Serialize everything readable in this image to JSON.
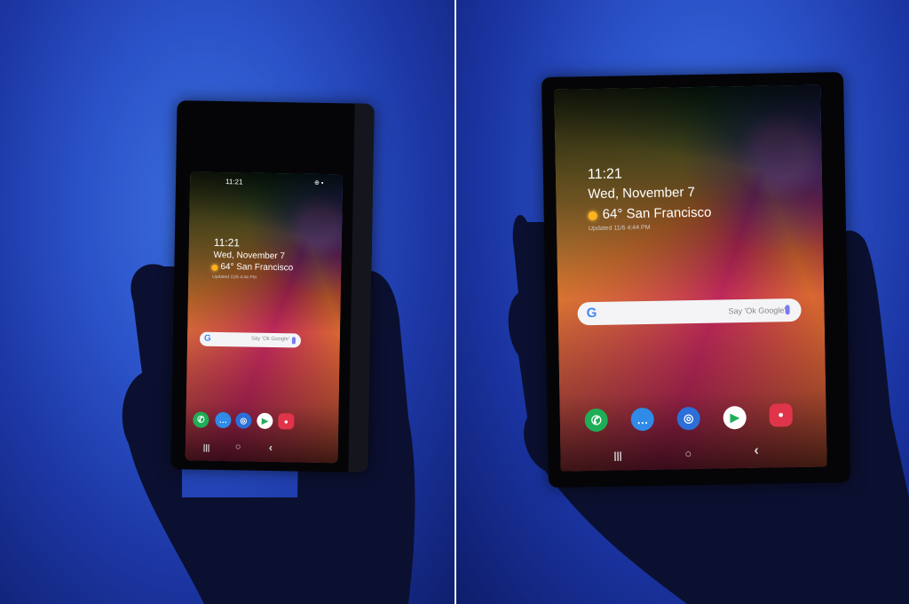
{
  "scene": {
    "description_free": true
  },
  "folded_phone": {
    "status_time": "11:21",
    "status_icons": "⊕ ▪",
    "clock": "11:21",
    "date": "Wed, November 7",
    "weather": "64° San Francisco",
    "updated": "Updated 11/6 4:44 PM",
    "search_placeholder": "Say 'Ok Google'",
    "google_logo": "G",
    "apps": [
      "phone-icon",
      "messages-icon",
      "internet-icon",
      "play-store-icon",
      "camera-icon"
    ],
    "nav": {
      "recent": "|||",
      "home": "○",
      "back": "‹"
    }
  },
  "unfolded_phone": {
    "clock": "11:21",
    "date": "Wed, November 7",
    "weather": "64° San Francisco",
    "updated": "Updated 11/6 4:44 PM",
    "search_placeholder": "Say 'Ok Google'",
    "google_logo": "G",
    "apps": [
      "phone-icon",
      "messages-icon",
      "internet-icon",
      "play-store-icon",
      "camera-icon"
    ],
    "nav": {
      "recent": "|||",
      "home": "○",
      "back": "‹"
    }
  },
  "colors": {
    "backdrop_blue": "#2b52c8",
    "accent_purple": "#b35cff",
    "sun": "#ffb21a"
  }
}
